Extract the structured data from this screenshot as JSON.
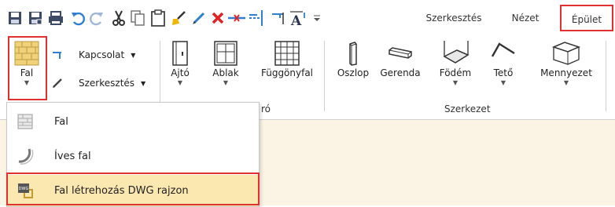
{
  "tabs": [
    {
      "label": "Szerkesztés"
    },
    {
      "label": "Nézet"
    },
    {
      "label": "Épület"
    }
  ],
  "toolbar": {
    "fal": {
      "label": "Fal"
    },
    "kapcsolat": {
      "label": "Kapcsolat"
    },
    "szerkesztes": {
      "label": "Szerkesztés"
    },
    "items": [
      {
        "label": "Ajtó"
      },
      {
        "label": "Ablak"
      },
      {
        "label": "Függönyfal"
      },
      {
        "label": "Oszlop"
      },
      {
        "label": "Gerenda"
      },
      {
        "label": "Födém"
      },
      {
        "label": "Tető"
      },
      {
        "label": "Mennyezet"
      }
    ]
  },
  "groups": {
    "partial": "ró",
    "szerkezet": "Szerkezet"
  },
  "menu": {
    "items": [
      {
        "label": "Fal"
      },
      {
        "label": "Íves fal"
      },
      {
        "label": "Fal létrehozás DWG rajzon"
      }
    ]
  },
  "colors": {
    "highlight_border": "#e03030",
    "menu_hover": "#fbe8b0",
    "canvas": "#fbf3e4"
  }
}
